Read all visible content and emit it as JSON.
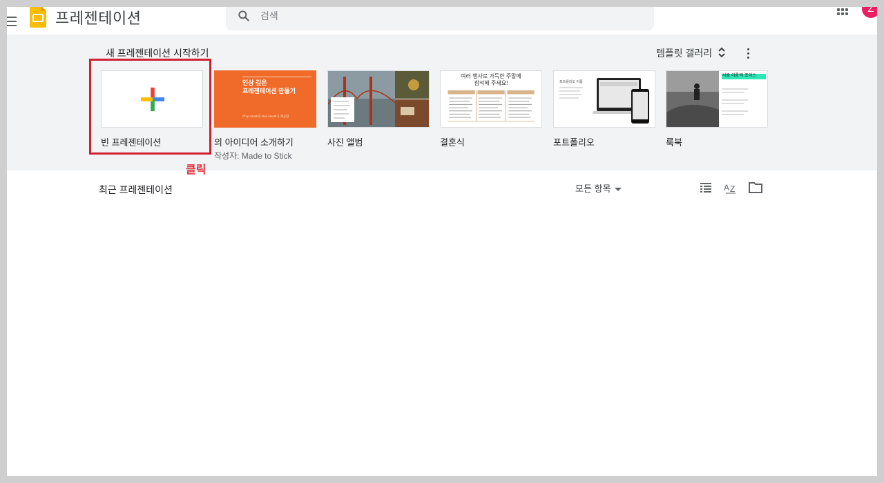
{
  "header": {
    "app_title": "프레젠테이션",
    "search_placeholder": "검색",
    "avatar_letter": "Z"
  },
  "templates": {
    "section_title": "새 프레젠테이션 시작하기",
    "gallery_label": "템플릿 갤러리",
    "items": [
      {
        "name": "빈 프레젠테이션",
        "author": ""
      },
      {
        "name": "의 아이디어 소개하기",
        "author": "작성자: Made to Stick",
        "thumb_title": "인상 깊은\n프레젠테이션 만들기",
        "thumb_sub": "Chip Heath과 Dan Heath가 제공함"
      },
      {
        "name": "사진 앨범",
        "author": ""
      },
      {
        "name": "결혼식",
        "author": "",
        "thumb_title": "여러 행사로 가득한 주말에\n참석해 주세요!"
      },
      {
        "name": "포트폴리오",
        "author": "",
        "thumb_title": "포트폴리오 이름"
      },
      {
        "name": "룩북",
        "author": "",
        "thumb_title": "'사람 이름'의 초이스"
      }
    ]
  },
  "annotation": {
    "click_label": "클릭"
  },
  "recent": {
    "title": "최근 프레젠테이션",
    "filter_label": "모든 항목"
  },
  "colors": {
    "accent_red": "#d32030",
    "slides_yellow": "#fbbc04",
    "orange_template": "#f06a2a",
    "avatar_pink": "#e91e63"
  }
}
